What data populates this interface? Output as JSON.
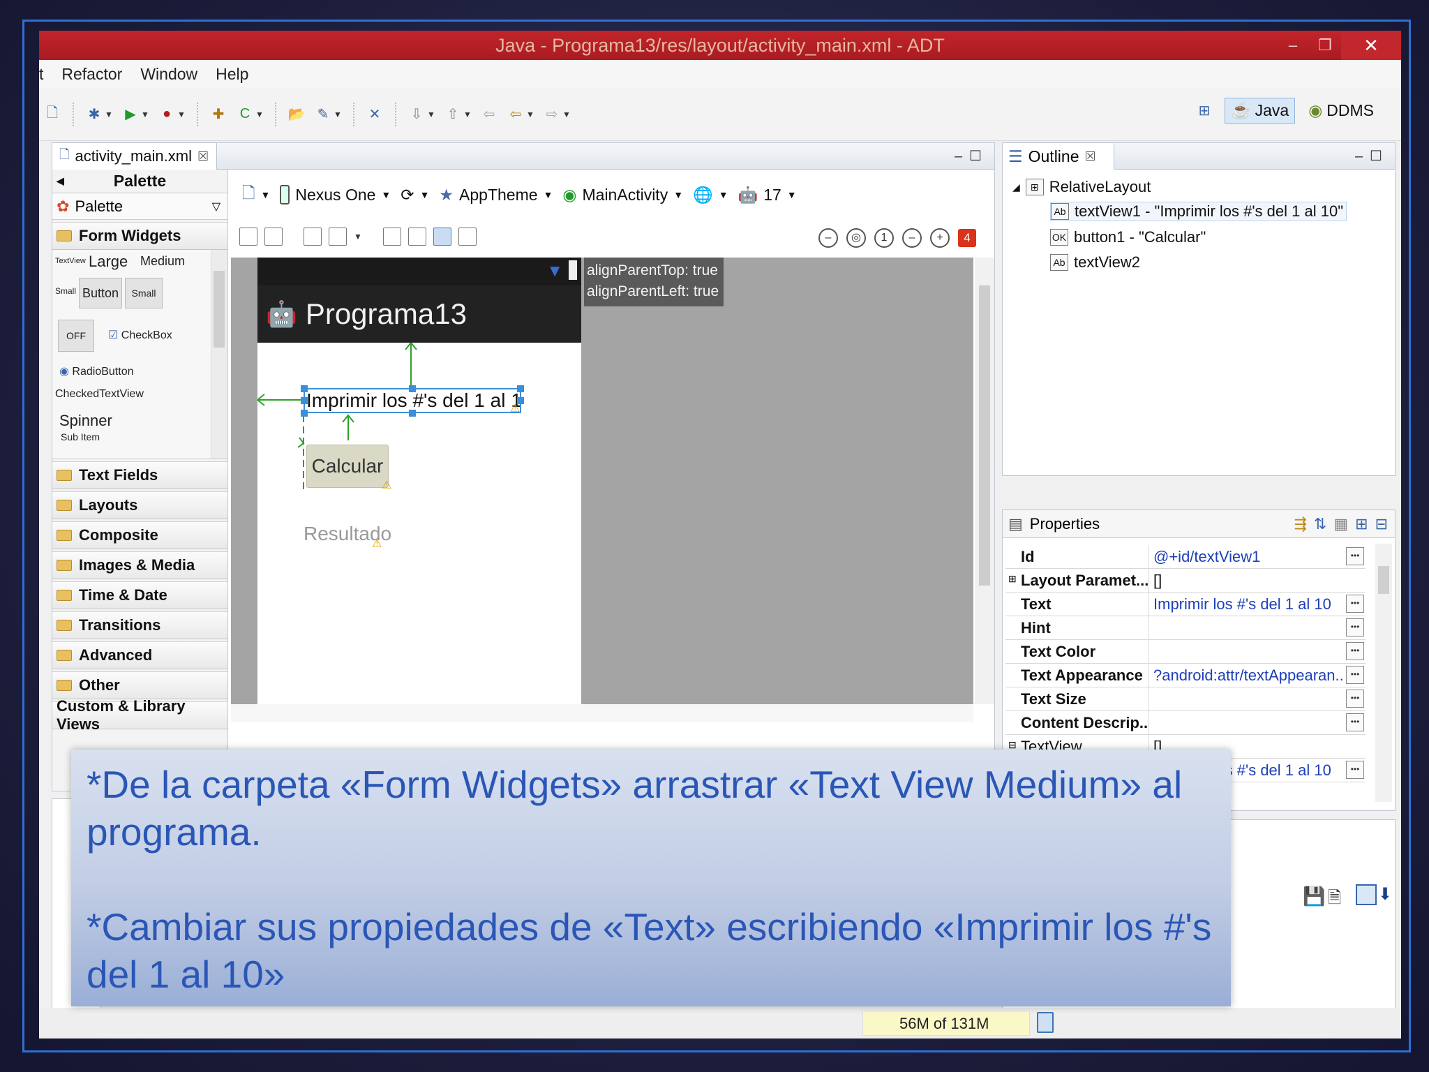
{
  "window": {
    "title": "Java - Programa13/res/layout/activity_main.xml - ADT"
  },
  "menu": [
    "t",
    "Refactor",
    "Window",
    "Help"
  ],
  "perspectives": {
    "java": "Java",
    "ddms": "DDMS"
  },
  "editor": {
    "tab_label": "activity_main.xml",
    "palette_title": "Palette",
    "palette_select": "Palette",
    "categories": [
      "Form Widgets",
      "Text Fields",
      "Layouts",
      "Composite",
      "Images & Media",
      "Time & Date",
      "Transitions",
      "Advanced",
      "Other",
      "Custom & Library Views"
    ],
    "widgets": {
      "textview_small": "TextView",
      "large": "Large",
      "medium": "Medium",
      "small": "Small",
      "button": "Button",
      "small_btn": "Small",
      "toggle": "OFF",
      "checkbox": "CheckBox",
      "radio": "RadioButton",
      "checked_textview": "CheckedTextView",
      "spinner": "Spinner",
      "sub_item": "Sub Item"
    },
    "config": {
      "device": "Nexus One",
      "theme": "AppTheme",
      "activity": "MainActivity",
      "api": "17"
    },
    "error_count": "4"
  },
  "device_preview": {
    "app_title": "Programa13",
    "textview1": "Imprimir los #'s del 1 al 10",
    "button1": "Calcular",
    "textview2": "Resultado",
    "tooltip_line1": "alignParentTop: true",
    "tooltip_line2": "alignParentLeft: true"
  },
  "outline": {
    "title": "Outline",
    "root": "RelativeLayout",
    "items": [
      {
        "icon": "Ab",
        "label": "textView1 - \"Imprimir los #'s del 1 al 10\""
      },
      {
        "icon": "OK",
        "label": "button1 - \"Calcular\""
      },
      {
        "icon": "Ab",
        "label": "textView2"
      }
    ]
  },
  "properties": {
    "title": "Properties",
    "rows": [
      {
        "key": "Id",
        "value": "@+id/textView1"
      },
      {
        "key": "Layout Paramet...",
        "value": "[]"
      },
      {
        "key": "Text",
        "value": "Imprimir los #'s del 1 al 10"
      },
      {
        "key": "Hint",
        "value": ""
      },
      {
        "key": "Text Color",
        "value": ""
      },
      {
        "key": "Text Appearance",
        "value": "?android:attr/textAppearan..."
      },
      {
        "key": "Text Size",
        "value": ""
      },
      {
        "key": "Content Descrip...",
        "value": ""
      },
      {
        "key": "TextView",
        "value": "[]"
      },
      {
        "key": "Text",
        "value": "Imprimir los #'s del 1 al 10"
      }
    ]
  },
  "status": {
    "memory_used": "56M",
    "memory_total": "of 131M"
  },
  "overlay": {
    "line1": "*De la carpeta «Form Widgets» arrastrar «Text View Medium» al programa.",
    "line2": "*Cambiar sus propiedades de «Text» escribiendo «Imprimir los #'s del 1 al 10»"
  },
  "colors": {
    "titlebar": "#b3202a",
    "overlay_text": "#2a56b6",
    "selection": "#3b8fd8"
  }
}
